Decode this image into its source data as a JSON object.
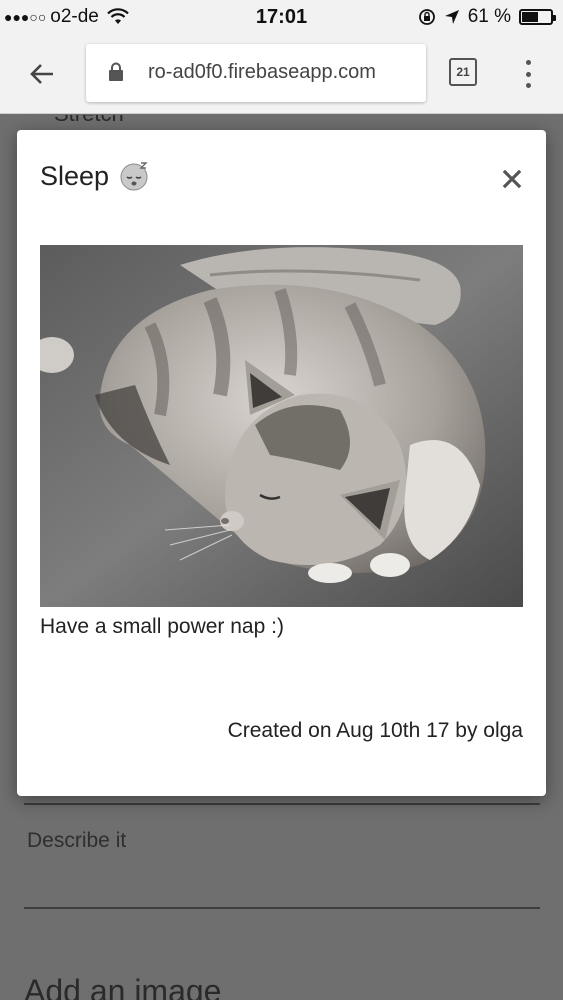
{
  "status_bar": {
    "signal_dots": "●●●○○",
    "carrier": "o2-de",
    "time": "17:01",
    "battery_percent": "61 %",
    "battery_level": 0.61
  },
  "toolbar": {
    "url": "ro-ad0f0.firebaseapp.com",
    "tab_count": "21"
  },
  "background": {
    "stretch_text": "Stretch",
    "describe_placeholder": "Describe it",
    "add_image_label": "Add an image"
  },
  "modal": {
    "title": "Sleep",
    "image_alt": "sleeping cat photo",
    "description": "Have a small power nap :)",
    "footer": "Created on Aug 10th 17 by olga"
  }
}
